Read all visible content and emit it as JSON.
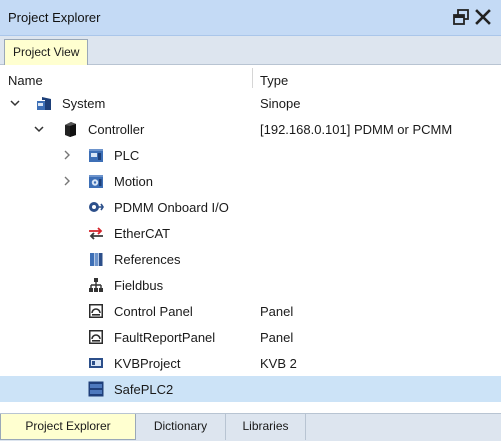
{
  "window": {
    "title": "Project Explorer",
    "restore_icon": "float-window-icon",
    "close_icon": "close-icon"
  },
  "inner_tab": {
    "label": "Project View"
  },
  "columns": {
    "name": "Name",
    "type": "Type"
  },
  "tree": {
    "items": [
      {
        "label": "System",
        "type": "Sinope",
        "icon": "system-icon",
        "expander": "expanded"
      },
      {
        "label": "Controller",
        "type": "[192.168.0.101] PDMM or PCMM",
        "icon": "controller-icon",
        "expander": "expanded"
      },
      {
        "label": "PLC",
        "type": "",
        "icon": "plc-icon",
        "expander": "collapsed"
      },
      {
        "label": "Motion",
        "type": "",
        "icon": "motion-icon",
        "expander": "collapsed"
      },
      {
        "label": "PDMM Onboard I/O",
        "type": "",
        "icon": "onboard-io-icon",
        "expander": "none"
      },
      {
        "label": "EtherCAT",
        "type": "",
        "icon": "ethercat-icon",
        "expander": "none"
      },
      {
        "label": "References",
        "type": "",
        "icon": "references-icon",
        "expander": "none"
      },
      {
        "label": "Fieldbus",
        "type": "",
        "icon": "fieldbus-icon",
        "expander": "none"
      },
      {
        "label": "Control Panel",
        "type": "Panel",
        "icon": "panel-icon",
        "expander": "none"
      },
      {
        "label": "FaultReportPanel",
        "type": "Panel",
        "icon": "panel-icon",
        "expander": "none"
      },
      {
        "label": "KVBProject",
        "type": "KVB 2",
        "icon": "kvb-project-icon",
        "expander": "none"
      },
      {
        "label": "SafePLC2",
        "type": "",
        "icon": "safeplc-icon",
        "expander": "none",
        "selected": true
      }
    ]
  },
  "bottom_tabs": [
    {
      "label": "Project Explorer",
      "active": true
    },
    {
      "label": "Dictionary",
      "active": false
    },
    {
      "label": "Libraries",
      "active": false
    }
  ]
}
